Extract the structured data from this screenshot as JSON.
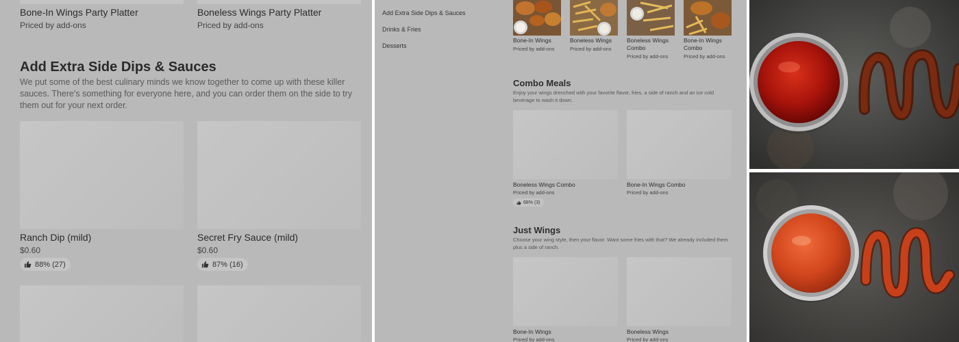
{
  "left": {
    "top_items": [
      {
        "name": "Bone-In Wings Party Platter",
        "sub": "Priced by add-ons"
      },
      {
        "name": "Boneless Wings Party Platter",
        "sub": "Priced by add-ons"
      }
    ],
    "section_title": "Add Extra Side Dips & Sauces",
    "section_desc": "We put some of the best culinary minds we know together to come up with these killer sauces. There's something for everyone here, and you can order them on the side to try them out for your next order.",
    "items": [
      {
        "name": "Ranch Dip (mild)",
        "price": "$0.60",
        "rating": "88% (27)"
      },
      {
        "name": "Secret Fry Sauce (mild)",
        "price": "$0.60",
        "rating": "87% (16)"
      }
    ]
  },
  "mid": {
    "nav": [
      "Add Extra Side Dips & Sauces",
      "Drinks & Fries",
      "Desserts"
    ],
    "top_items": [
      {
        "name": "Bone-In Wings",
        "sub": "Priced by add-ons"
      },
      {
        "name": "Boneless Wings",
        "sub": "Priced by add-ons"
      },
      {
        "name": "Boneless Wings Combo",
        "sub": "Priced by add-ons"
      },
      {
        "name": "Bone-In Wings Combo",
        "sub": "Priced by add-ons"
      }
    ],
    "combo": {
      "title": "Combo Meals",
      "desc": "Enjoy your wings drenched with your favorite flavor, fries, a side of ranch and an ice cold beverage to wash it down.",
      "items": [
        {
          "name": "Boneless Wings Combo",
          "sub": "Priced by add-ons",
          "rating": "68% (3)"
        },
        {
          "name": "Bone-In Wings Combo",
          "sub": "Priced by add-ons"
        }
      ]
    },
    "just_wings": {
      "title": "Just Wings",
      "desc": "Choose your wing style, then your flavor. Want some fries with that? We already included them plus a side of ranch.",
      "items": [
        {
          "name": "Bone-In Wings",
          "sub": "Priced by add-ons"
        },
        {
          "name": "Boneless Wings",
          "sub": "Priced by add-ons"
        }
      ]
    }
  },
  "icons": {
    "rating": "thumbs-up-icon"
  },
  "colors": {
    "overlay": "#b9b9b9",
    "sauce_red": "#b3160c",
    "sauce_orange": "#d2471d"
  }
}
